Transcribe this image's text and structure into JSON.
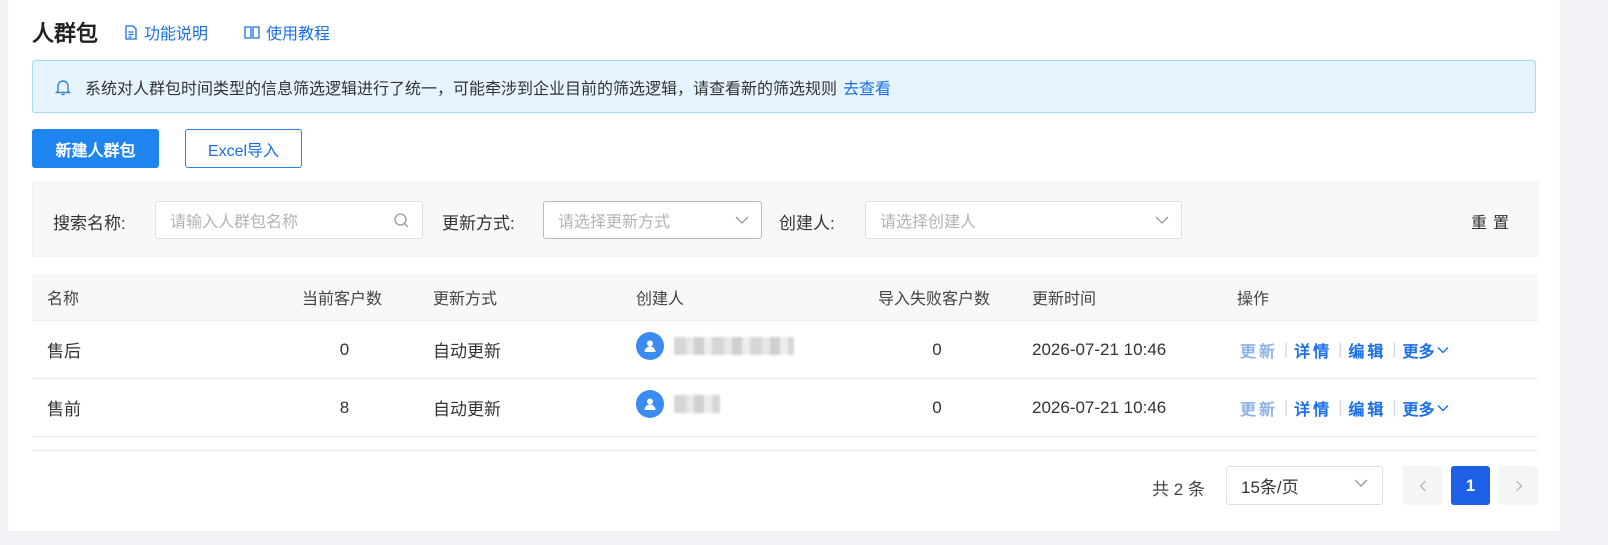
{
  "header": {
    "title": "人群包",
    "links": [
      {
        "label": "功能说明",
        "icon": "document-icon"
      },
      {
        "label": "使用教程",
        "icon": "book-icon"
      }
    ]
  },
  "notice": {
    "icon": "bell-icon",
    "text": "系统对人群包时间类型的信息筛选逻辑进行了统一，可能牵涉到企业目前的筛选逻辑，请查看新的筛选规则",
    "link": "去查看"
  },
  "toolbar": {
    "create_label": "新建人群包",
    "import_label": "Excel导入"
  },
  "filters": {
    "name_label": "搜索名称:",
    "name_placeholder": "请输入人群包名称",
    "update_label": "更新方式:",
    "update_placeholder": "请选择更新方式",
    "creator_label": "创建人:",
    "creator_placeholder": "请选择创建人",
    "reset_label": "重置"
  },
  "table": {
    "columns": [
      "名称",
      "当前客户数",
      "更新方式",
      "创建人",
      "导入失败客户数",
      "更新时间",
      "操作"
    ],
    "rows": [
      {
        "name": "售后",
        "count": "0",
        "update_mode": "自动更新",
        "failed": "0",
        "updated_at": "2026-07-21 10:46"
      },
      {
        "name": "售前",
        "count": "8",
        "update_mode": "自动更新",
        "failed": "0",
        "updated_at": "2026-07-21 10:46"
      }
    ],
    "actions": {
      "update": "更新",
      "detail": "详情",
      "edit": "编辑",
      "more": "更多"
    }
  },
  "pagination": {
    "total_text": "共 2 条",
    "page_size": "15条/页",
    "current_page": "1"
  },
  "colors": {
    "primary": "#1d84f0",
    "link": "#1a6fe6",
    "notice_bg": "#e6f4ff",
    "avatar": "#3b8cf2"
  }
}
